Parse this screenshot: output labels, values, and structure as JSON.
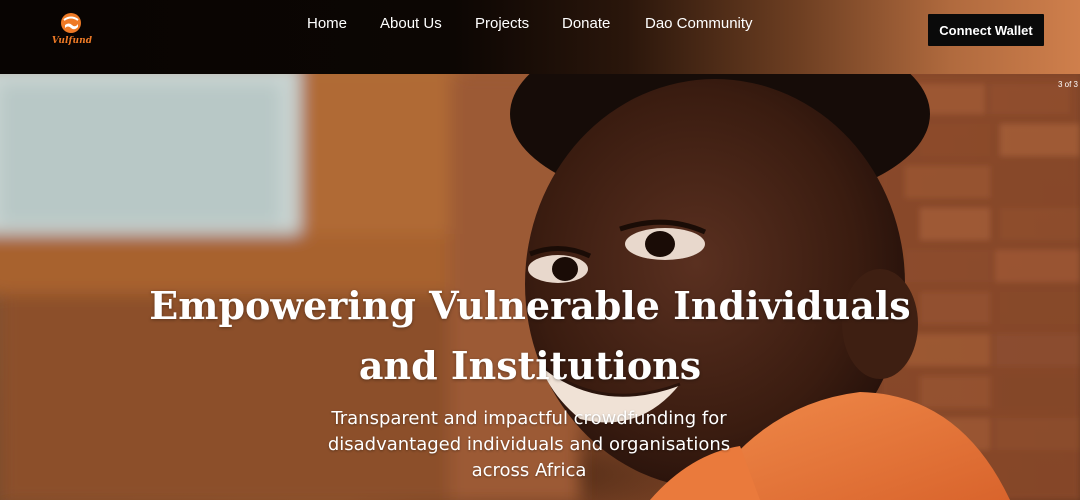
{
  "brand": {
    "name": "Vulfund",
    "accent_color": "#ee7a26",
    "logo_icon": "globe-hand-icon"
  },
  "nav": {
    "items": [
      {
        "label": "Home"
      },
      {
        "label": "About Us"
      },
      {
        "label": "Projects"
      },
      {
        "label": "Donate"
      },
      {
        "label": "Dao Community"
      }
    ],
    "connect_wallet_label": "Connect Wallet"
  },
  "hero": {
    "slide_counter": "3 of 3",
    "title_line1": "Empowering Vulnerable Individuals",
    "title_line2": "and Institutions",
    "subtitle_line1": "Transparent and impactful crowdfunding for",
    "subtitle_line2": "disadvantaged individuals and organisations",
    "subtitle_line3": "across Africa"
  }
}
